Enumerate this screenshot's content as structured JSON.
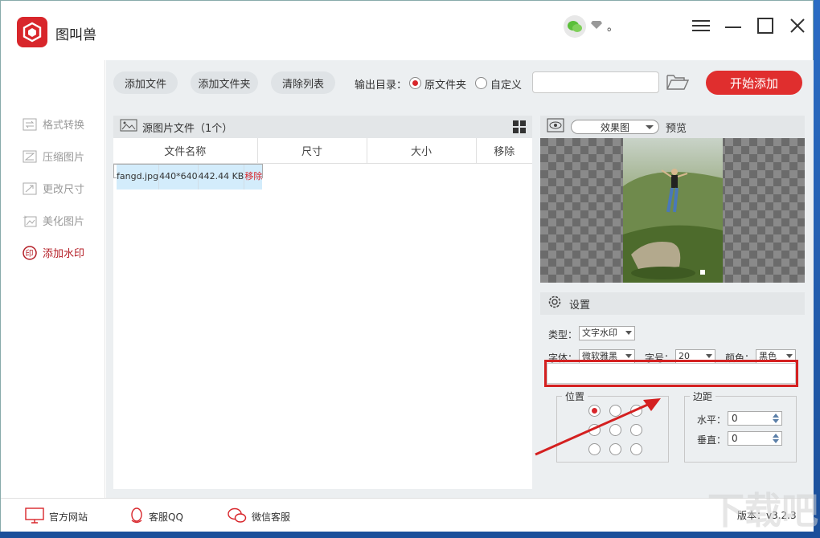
{
  "app": {
    "title": "图叫兽",
    "user_name": "。"
  },
  "toolbar": {
    "add_file": "添加文件",
    "add_folder": "添加文件夹",
    "clear_list": "清除列表",
    "output_label": "输出目录：",
    "option_original": "原文件夹",
    "option_custom": "自定义",
    "output_path": "",
    "start": "开始添加"
  },
  "sidebar": {
    "items": [
      {
        "label": "格式转换",
        "icon": "convert-icon",
        "active": false
      },
      {
        "label": "压缩图片",
        "icon": "compress-icon",
        "active": false
      },
      {
        "label": "更改尺寸",
        "icon": "resize-icon",
        "active": false
      },
      {
        "label": "美化图片",
        "icon": "beautify-icon",
        "active": false
      },
      {
        "label": "添加水印",
        "icon": "watermark-icon",
        "active": true
      }
    ]
  },
  "files": {
    "header": "源图片文件（1个）",
    "columns": [
      "文件名称",
      "尺寸",
      "大小",
      "移除"
    ],
    "rows": [
      {
        "name": "fangd.jpg",
        "size": "440*640",
        "filesize": "442.44 KB",
        "remove": "移除"
      }
    ]
  },
  "preview": {
    "mode": "效果图",
    "label": "预览"
  },
  "settings": {
    "title": "设置",
    "type_label": "类型：",
    "type_value": "文字水印",
    "font_label": "字体：",
    "font_value": "微软雅黑",
    "size_label": "字号：",
    "size_value": "20",
    "color_label": "颜色：",
    "color_value": "黑色",
    "watermark_text": "",
    "position_label": "位置",
    "margin_label": "边距",
    "horizontal_label": "水平：",
    "horizontal_value": "0",
    "vertical_label": "垂直：",
    "vertical_value": "0"
  },
  "footer": {
    "website": "官方网站",
    "qq": "客服QQ",
    "wechat": "微信客服",
    "version": "版本：v3.2.3"
  },
  "colors": {
    "accent": "#d8262b",
    "start_button": "#e02e2e",
    "selected_row": "#d3ecfb"
  }
}
